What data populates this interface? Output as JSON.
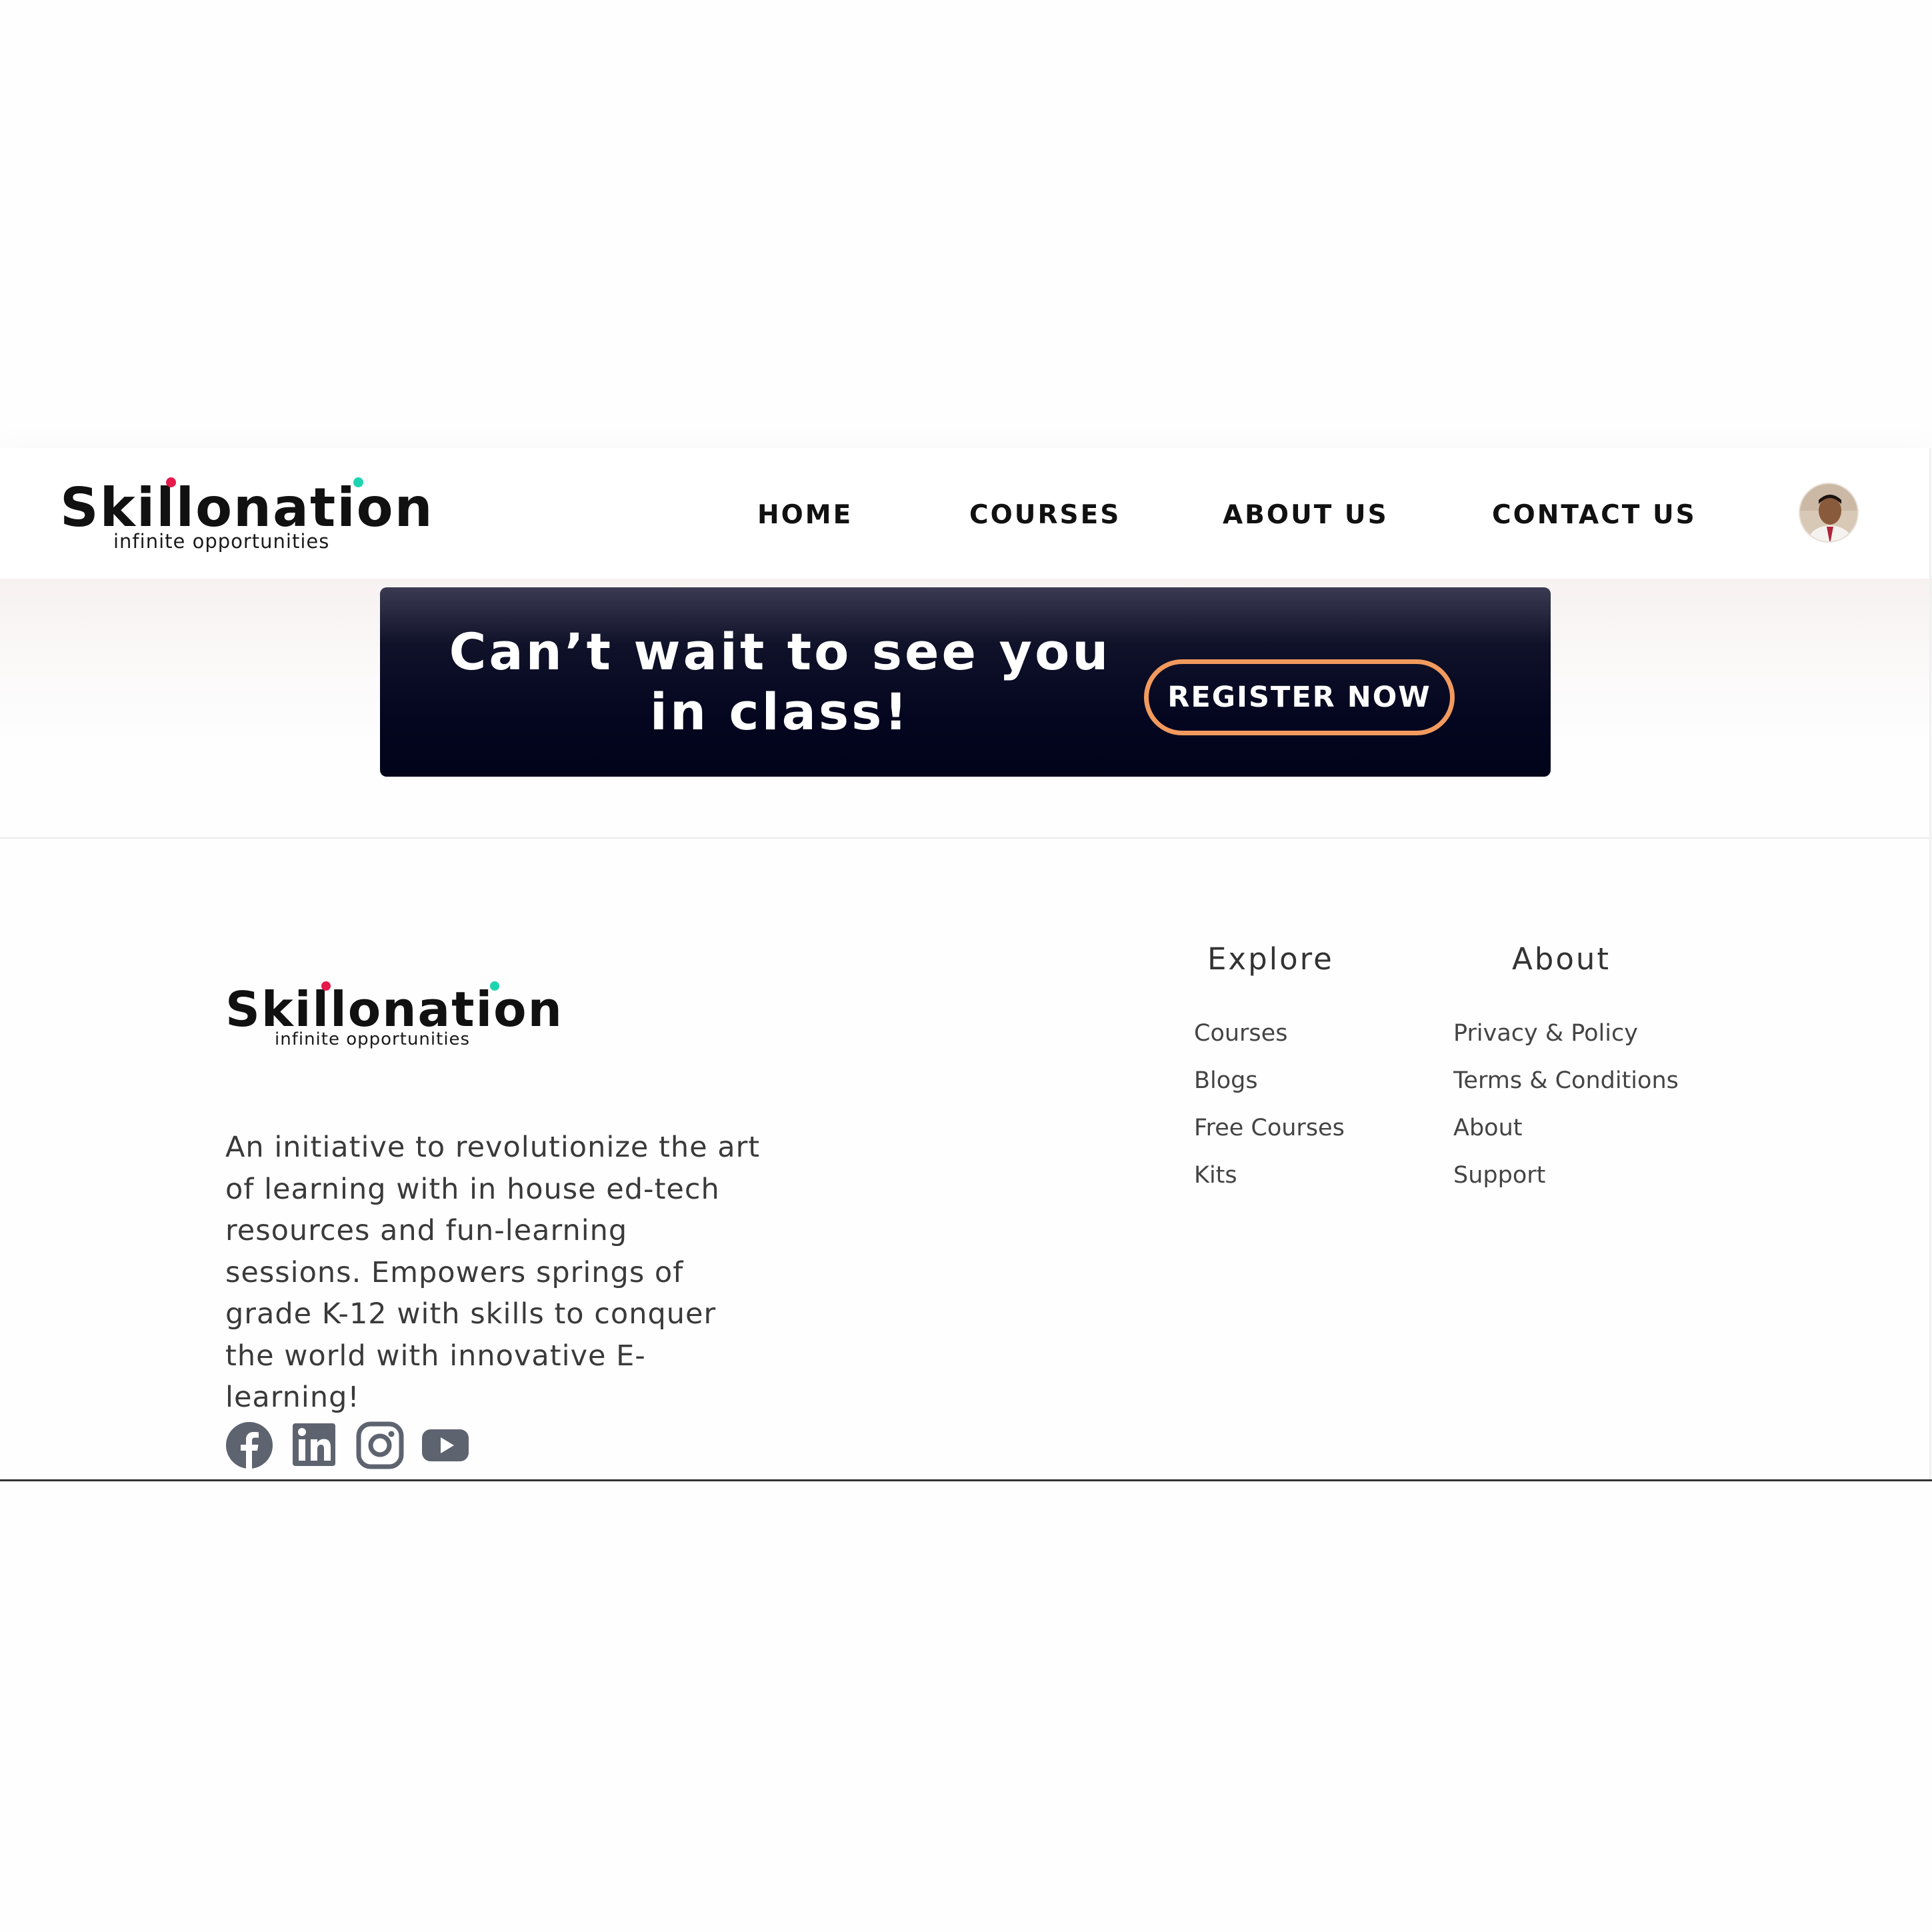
{
  "header": {
    "logo": {
      "word": "Skillonation",
      "tagline": "infinite opportunities"
    },
    "nav": [
      {
        "label": "HOME"
      },
      {
        "label": "COURSES"
      },
      {
        "label": "ABOUT US"
      },
      {
        "label": "CONTACT US"
      }
    ],
    "avatar_icon": "user-avatar"
  },
  "cta": {
    "text": "Can’t wait to see you in class!",
    "button_label": "REGISTER NOW",
    "button_border_color": "#f29a5e",
    "background_color": "#040620"
  },
  "footer": {
    "logo": {
      "word": "Skillonation",
      "tagline": "infinite opportunities"
    },
    "description": "An initiative to revolutionize the art of learning with in house ed-tech resources and fun-learning sessions. Empowers springs of grade K-12 with skills to conquer the world with innovative E-learning!",
    "social_icons": [
      "facebook-icon",
      "linkedin-icon",
      "instagram-icon",
      "youtube-icon"
    ],
    "explore": {
      "heading": "Explore",
      "links": [
        "Courses",
        "Blogs",
        "Free Courses",
        "Kits"
      ]
    },
    "about": {
      "heading": "About",
      "links": [
        "Privacy & Policy",
        "Terms & Conditions",
        "About",
        "Support"
      ]
    }
  }
}
